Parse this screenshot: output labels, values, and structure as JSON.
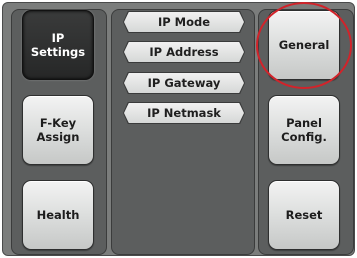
{
  "left_column": {
    "buttons": [
      {
        "label": "IP\nSettings",
        "active": true
      },
      {
        "label": "F-Key\nAssign",
        "active": false
      },
      {
        "label": "Health",
        "active": false
      }
    ]
  },
  "middle_column": {
    "tags": [
      {
        "label": "IP Mode"
      },
      {
        "label": "IP Address"
      },
      {
        "label": "IP Gateway"
      },
      {
        "label": "IP Netmask"
      }
    ]
  },
  "right_column": {
    "buttons": [
      {
        "label": "General",
        "highlighted": true
      },
      {
        "label": "Panel\nConfig.",
        "highlighted": false
      },
      {
        "label": "Reset",
        "highlighted": false
      }
    ]
  },
  "colors": {
    "highlight_ring": "#d2232a",
    "active_button": "#2b2c2c",
    "panel_background": "#5c5e5e"
  }
}
